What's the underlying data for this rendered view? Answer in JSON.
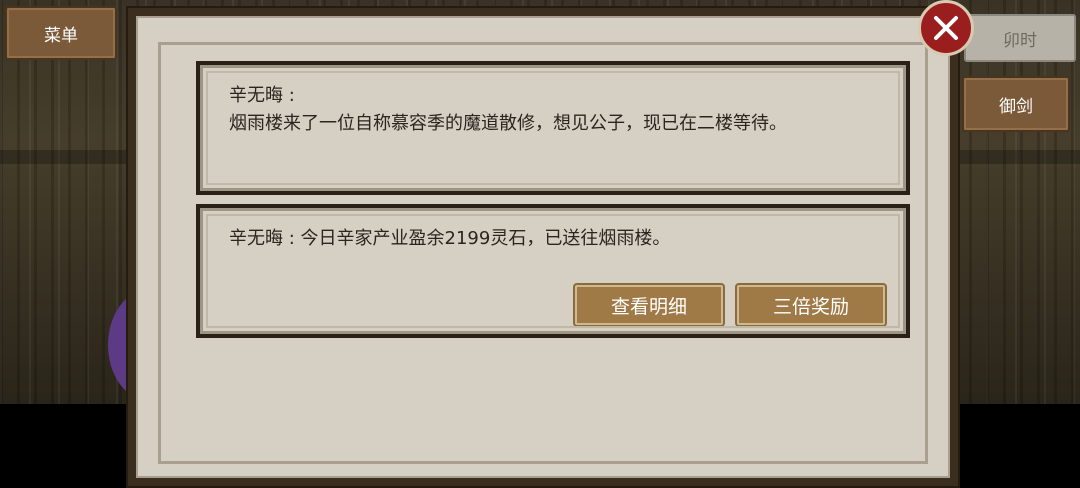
{
  "top_left_menu": {
    "label": "菜单"
  },
  "right_buttons": {
    "time_label": "卯时",
    "sword_label": "御剑"
  },
  "messages": [
    {
      "speaker": "辛无晦 :",
      "text": "烟雨楼来了一位自称慕容季的魔道散修，想见公子，现已在二楼等待。"
    },
    {
      "line": "辛无晦 : 今日辛家产业盈余2199灵石，已送往烟雨楼。",
      "buttons": {
        "details": "查看明细",
        "triple_reward": "三倍奖励"
      }
    }
  ],
  "colors": {
    "close_button": "#9b1e1e",
    "action_button": "#a07a46",
    "panel": "#d6cfc3"
  }
}
